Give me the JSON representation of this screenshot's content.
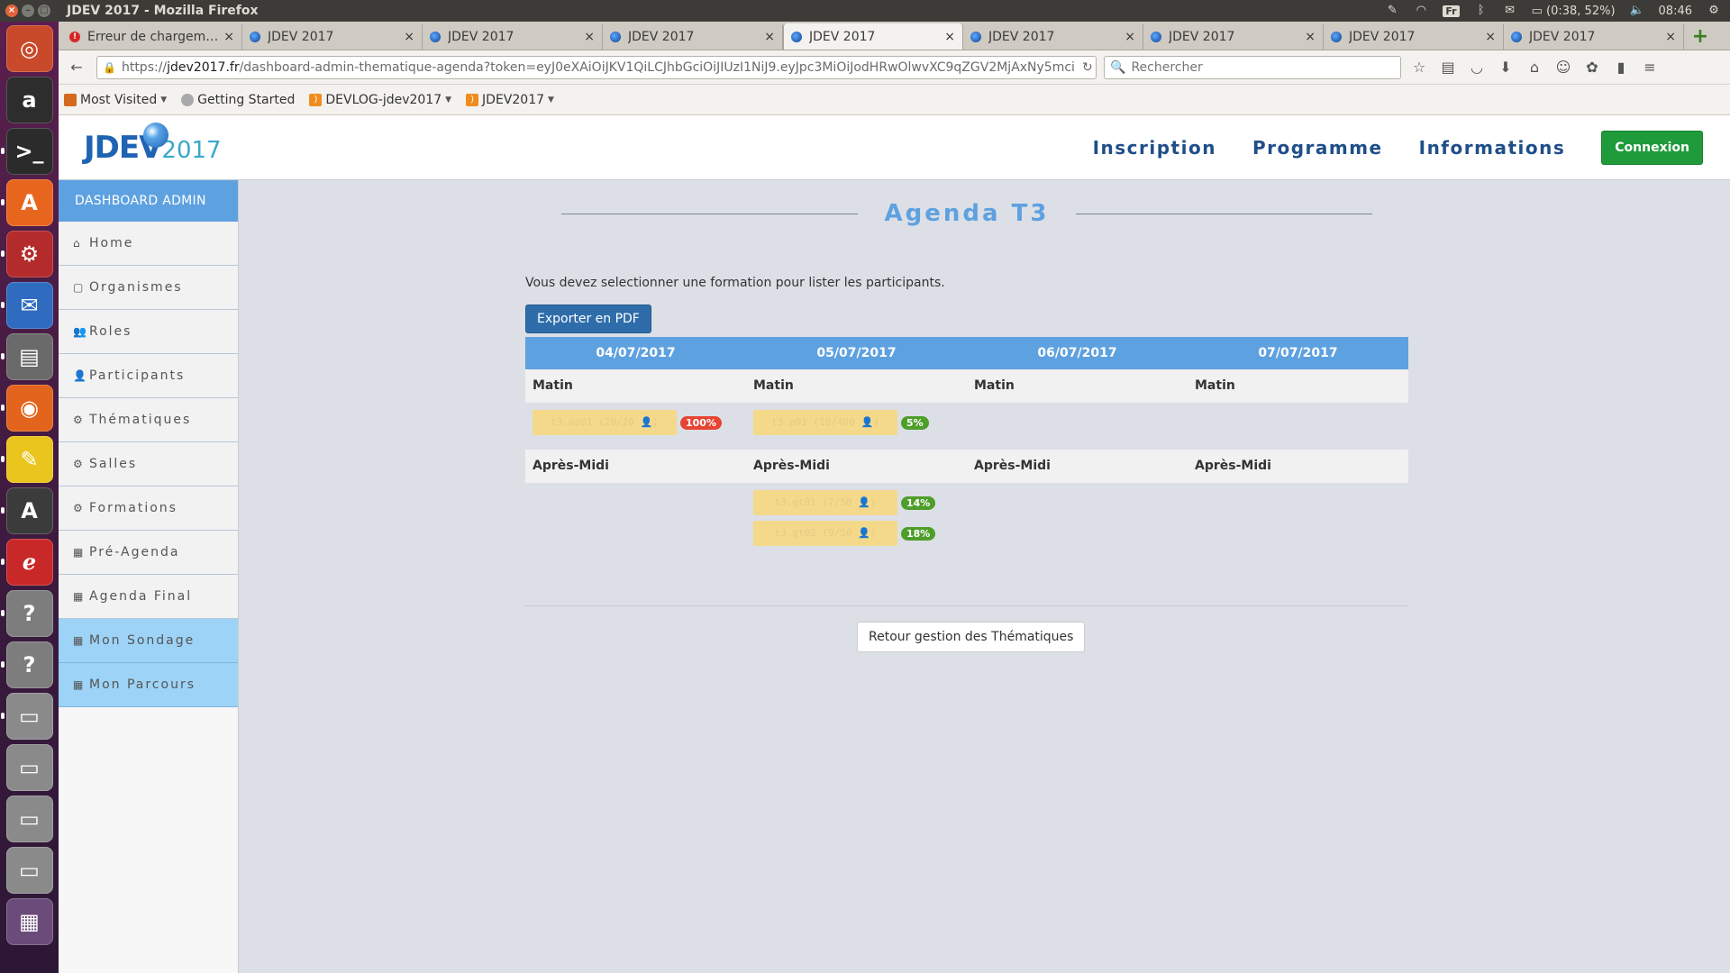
{
  "os_panel": {
    "window_title": "JDEV 2017 - Mozilla Firefox",
    "keyboard": "Fr",
    "battery": "(0:38, 52%)",
    "clock": "08:46"
  },
  "launcher": {
    "items": [
      {
        "name": "ubuntu-dash",
        "glyph": "◎",
        "color": "#c84a2a"
      },
      {
        "name": "amazon",
        "glyph": "a",
        "color": "#2d2d2d"
      },
      {
        "name": "terminal",
        "glyph": ">_",
        "color": "#2b2b2b"
      },
      {
        "name": "software-center",
        "glyph": "A",
        "color": "#e8651e"
      },
      {
        "name": "system-settings",
        "glyph": "⚙",
        "color": "#b32b2b"
      },
      {
        "name": "thunderbird",
        "glyph": "✉",
        "color": "#2f6bbf"
      },
      {
        "name": "files",
        "glyph": "▤",
        "color": "#6a6a6a"
      },
      {
        "name": "firefox",
        "glyph": "◉",
        "color": "#e3641c"
      },
      {
        "name": "text-editor",
        "glyph": "✎",
        "color": "#e9c51d"
      },
      {
        "name": "update-manager",
        "glyph": "A",
        "color": "#3b3b3b"
      },
      {
        "name": "acrobat-reader",
        "glyph": "ℯ",
        "color": "#c92828"
      },
      {
        "name": "unknown-app-1",
        "glyph": "?",
        "color": "#7d7d7d"
      },
      {
        "name": "unknown-app-2",
        "glyph": "?",
        "color": "#7d7d7d"
      },
      {
        "name": "drive-1",
        "glyph": "▭",
        "color": "#8a8a8a"
      },
      {
        "name": "drive-2",
        "glyph": "▭",
        "color": "#8a8a8a"
      },
      {
        "name": "drive-3",
        "glyph": "▭",
        "color": "#8a8a8a"
      },
      {
        "name": "drive-4",
        "glyph": "▭",
        "color": "#8a8a8a"
      },
      {
        "name": "workspaces",
        "glyph": "▦",
        "color": "#6b4b7a"
      }
    ]
  },
  "tabs": [
    {
      "label": "Erreur de chargement",
      "error": true,
      "active": false
    },
    {
      "label": "JDEV 2017",
      "error": false,
      "active": false
    },
    {
      "label": "JDEV 2017",
      "error": false,
      "active": false
    },
    {
      "label": "JDEV 2017",
      "error": false,
      "active": false
    },
    {
      "label": "JDEV 2017",
      "error": false,
      "active": true
    },
    {
      "label": "JDEV 2017",
      "error": false,
      "active": false
    },
    {
      "label": "JDEV 2017",
      "error": false,
      "active": false
    },
    {
      "label": "JDEV 2017",
      "error": false,
      "active": false
    },
    {
      "label": "JDEV 2017",
      "error": false,
      "active": false
    }
  ],
  "url": {
    "prefix": "https://",
    "domain": "jdev2017.fr",
    "path": "/dashboard-admin-thematique-agenda?token=eyJ0eXAiOiJKV1QiLCJhbGciOiJIUzI1NiJ9.eyJpc3MiOiJodHRwOlwvXC9qZGV2MjAxNy5mci"
  },
  "search": {
    "placeholder": "Rechercher"
  },
  "bookmarks": [
    {
      "label": "Most Visited",
      "icon": "most",
      "dropdown": true
    },
    {
      "label": "Getting Started",
      "icon": "globe",
      "dropdown": false
    },
    {
      "label": "DEVLOG-jdev2017",
      "icon": "rss",
      "dropdown": true
    },
    {
      "label": "JDEV2017",
      "icon": "rss",
      "dropdown": true
    }
  ],
  "site": {
    "logo_text": "JDEV",
    "logo_year": "2017",
    "nav": [
      "Inscription",
      "Programme",
      "Informations"
    ],
    "login_label": "Connexion"
  },
  "sidebar": {
    "title": "DASHBOARD ADMIN",
    "items": [
      {
        "label": "Home",
        "icon": "home-icon",
        "glyph": "⌂",
        "highlight": false
      },
      {
        "label": "Organismes",
        "icon": "document-icon",
        "glyph": "▢",
        "highlight": false
      },
      {
        "label": "Roles",
        "icon": "users-icon",
        "glyph": "👥",
        "highlight": false
      },
      {
        "label": "Participants",
        "icon": "user-icon",
        "glyph": "👤",
        "highlight": false
      },
      {
        "label": "Thématiques",
        "icon": "cogs-icon",
        "glyph": "⚙",
        "highlight": false
      },
      {
        "label": "Salles",
        "icon": "cogs-icon",
        "glyph": "⚙",
        "highlight": false
      },
      {
        "label": "Formations",
        "icon": "cogs-icon",
        "glyph": "⚙",
        "highlight": false
      },
      {
        "label": "Pré-Agenda",
        "icon": "calendar-icon",
        "glyph": "▦",
        "highlight": false
      },
      {
        "label": "Agenda Final",
        "icon": "calendar-icon",
        "glyph": "▦",
        "highlight": false
      },
      {
        "label": "Mon Sondage",
        "icon": "calendar-icon",
        "glyph": "▦",
        "highlight": true
      },
      {
        "label": "Mon Parcours",
        "icon": "calendar-icon",
        "glyph": "▦",
        "highlight": true
      }
    ]
  },
  "main": {
    "title": "Agenda T3",
    "hint": "Vous devez selectionner une formation pour lister les participants.",
    "export_label": "Exporter en PDF",
    "back_label": "Retour gestion des Thématiques",
    "days": [
      "04/07/2017",
      "05/07/2017",
      "06/07/2017",
      "07/07/2017"
    ],
    "morning_label": "Matin",
    "afternoon_label": "Après-Midi",
    "morning": [
      [
        {
          "code": "t3.ap01 (20/20 👤)",
          "pct": "100%",
          "level": "red"
        }
      ],
      [
        {
          "code": "t3.p01 (19/400 👤)",
          "pct": "5%",
          "level": "green"
        }
      ],
      [],
      []
    ],
    "afternoon": [
      [],
      [
        {
          "code": "t3.gt01 (7/50 👤)",
          "pct": "14%",
          "level": "green"
        },
        {
          "code": "t3.gt02 (9/50 👤)",
          "pct": "18%",
          "level": "green"
        }
      ],
      [],
      []
    ]
  }
}
